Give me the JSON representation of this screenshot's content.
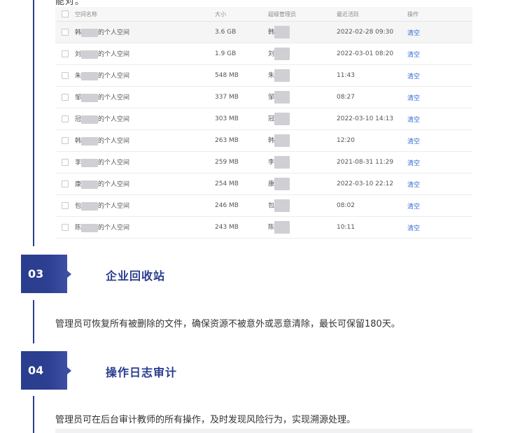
{
  "top_text": "能对。",
  "table": {
    "headers": {
      "name": "空间名称",
      "size": "大小",
      "admin": "超级管理员",
      "last_active": "最近活跃",
      "action": "操作"
    },
    "rows": [
      {
        "name_prefix": "韩",
        "name_suffix": "的个人空间",
        "size": "3.6 GB",
        "admin": "韩",
        "last_active": "2022-02-28 09:30",
        "action": "清空"
      },
      {
        "name_prefix": "刘",
        "name_suffix": "的个人空间",
        "size": "1.9 GB",
        "admin": "刘",
        "last_active": "2022-03-01 08:20",
        "action": "清空"
      },
      {
        "name_prefix": "朱",
        "name_suffix": "的个人空间",
        "size": "548 MB",
        "admin": "朱",
        "last_active": "11:43",
        "action": "清空"
      },
      {
        "name_prefix": "邹",
        "name_suffix": "的个人空间",
        "size": "337 MB",
        "admin": "邹",
        "last_active": "08:27",
        "action": "清空"
      },
      {
        "name_prefix": "冠",
        "name_suffix": "的个人空间",
        "size": "303 MB",
        "admin": "冠",
        "last_active": "2022-03-10 14:13",
        "action": "清空"
      },
      {
        "name_prefix": "韩",
        "name_suffix": "的个人空间",
        "size": "263 MB",
        "admin": "韩",
        "last_active": "12:20",
        "action": "清空"
      },
      {
        "name_prefix": "李",
        "name_suffix": "的个人空间",
        "size": "259 MB",
        "admin": "李",
        "last_active": "2021-08-31 11:29",
        "action": "清空"
      },
      {
        "name_prefix": "康",
        "name_suffix": "的个人空间",
        "size": "254 MB",
        "admin": "康",
        "last_active": "2022-03-10 22:12",
        "action": "清空"
      },
      {
        "name_prefix": "包",
        "name_suffix": "的个人空间",
        "size": "246 MB",
        "admin": "包",
        "last_active": "08:02",
        "action": "清空"
      },
      {
        "name_prefix": "陈",
        "name_suffix": "的个人空间",
        "size": "243 MB",
        "admin": "陈",
        "last_active": "10:11",
        "action": "清空"
      }
    ]
  },
  "sections": [
    {
      "number": "03",
      "title": "企业回收站",
      "desc": "管理员可恢复所有被删除的文件，确保资源不被意外或恶意清除，最长可保留180天。"
    },
    {
      "number": "04",
      "title": "操作日志审计",
      "desc": "管理员可在后台审计教师的所有操作，及时发现风险行为，实现溯源处理。"
    }
  ],
  "colors": {
    "accent": "#2a3d8f",
    "link": "#2d6ad6"
  }
}
